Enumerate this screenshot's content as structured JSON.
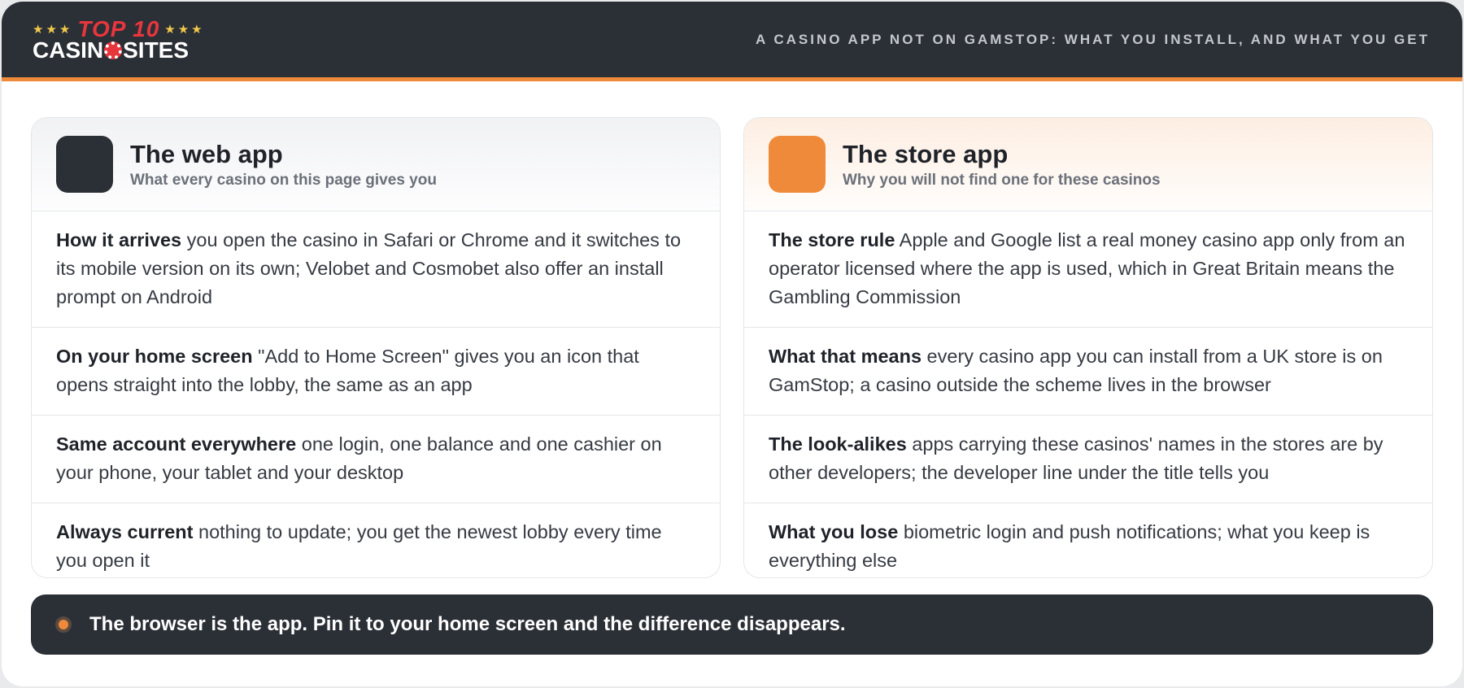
{
  "header": {
    "logo_stars_left": "★★★",
    "logo_top": "TOP 10",
    "logo_stars_right": "★★★",
    "logo_word_left": "CASIN",
    "logo_word_right": "SITES",
    "title": "A CASINO APP NOT ON GAMSTOP: WHAT YOU INSTALL, AND WHAT YOU GET"
  },
  "colors": {
    "dark": "#2b2f36",
    "accent": "#ee8a3a",
    "logo_red": "#e8363d",
    "star": "#f2c94c"
  },
  "web_card": {
    "title": "The web app",
    "subtitle": "What every casino on this page gives you",
    "rows": [
      {
        "lead": "How it arrives",
        "text": " you open the casino in Safari or Chrome and it switches to its mobile version on its own; Velobet and Cosmobet also offer an install prompt on Android"
      },
      {
        "lead": "On your home screen",
        "text": " \"Add to Home Screen\" gives you an icon that opens straight into the lobby, the same as an app"
      },
      {
        "lead": "Same account everywhere",
        "text": " one login, one balance and one cashier on your phone, your tablet and your desktop"
      },
      {
        "lead": "Always current",
        "text": " nothing to update; you get the newest lobby every time you open it"
      }
    ]
  },
  "store_card": {
    "title": "The store app",
    "subtitle": "Why you will not find one for these casinos",
    "rows": [
      {
        "lead": "The store rule",
        "text": " Apple and Google list a real money casino app only from an operator licensed where the app is used, which in Great Britain means the Gambling Commission"
      },
      {
        "lead": "What that means",
        "text": " every casino app you can install from a UK store is on GamStop; a casino outside the scheme lives in the browser"
      },
      {
        "lead": "The look-alikes",
        "text": " apps carrying these casinos' names in the stores are by other developers; the developer line under the title tells you"
      },
      {
        "lead": "What you lose",
        "text": " biometric login and push notifications; what you keep is everything else"
      }
    ]
  },
  "banner": {
    "text": "The browser is the app. Pin it to your home screen and the difference disappears."
  }
}
